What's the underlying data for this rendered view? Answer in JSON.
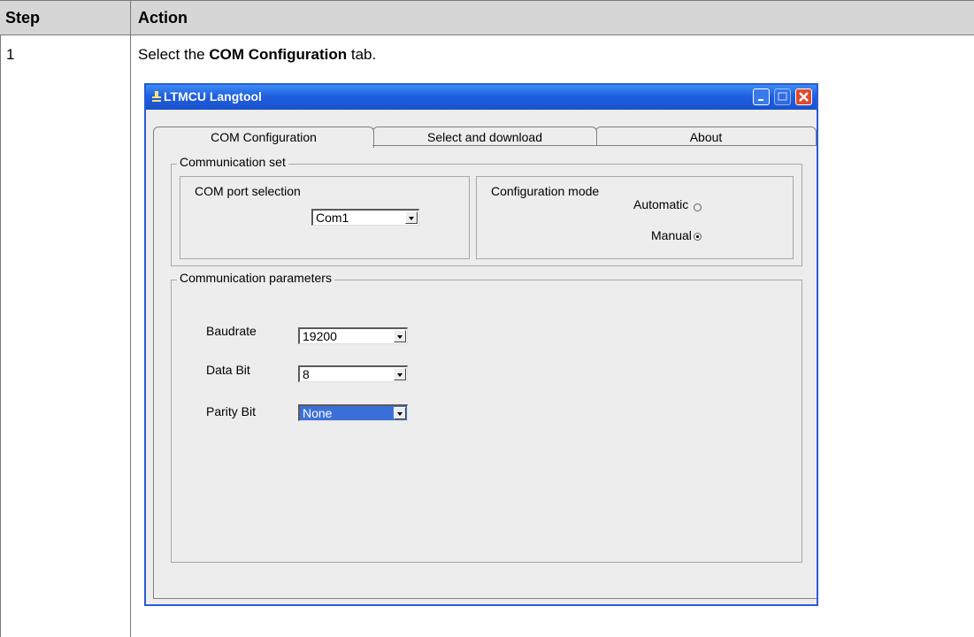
{
  "table": {
    "header_step": "Step",
    "header_action": "Action",
    "row_step": "1",
    "instruction_before": "Select the ",
    "instruction_bold": "COM Configuration",
    "instruction_after": " tab."
  },
  "window": {
    "title": "LTMCU Langtool",
    "tabs": [
      {
        "label": "COM Configuration",
        "active": true
      },
      {
        "label": "Select and download",
        "active": false
      },
      {
        "label": "About",
        "active": false
      }
    ],
    "communication_set": {
      "title": "Communication set",
      "com_port": {
        "label": "COM port selection",
        "value": "Com1"
      },
      "config_mode": {
        "label": "Configuration mode",
        "automatic_label": "Automatic",
        "manual_label": "Manual",
        "selected": "Manual"
      }
    },
    "communication_parameters": {
      "title": "Communication parameters",
      "baudrate_label": "Baudrate",
      "baudrate_value": "19200",
      "databit_label": "Data Bit",
      "databit_value": "8",
      "parity_label": "Parity Bit",
      "parity_value": "None"
    }
  },
  "colors": {
    "titlebar": "#1f5fe0",
    "close_button": "#e0492b",
    "selection": "#3c6fd8",
    "header_bg": "#d6d6d6"
  },
  "icons": [
    "app-icon",
    "minimize-icon",
    "maximize-icon",
    "close-icon",
    "dropdown-arrow-icon"
  ]
}
